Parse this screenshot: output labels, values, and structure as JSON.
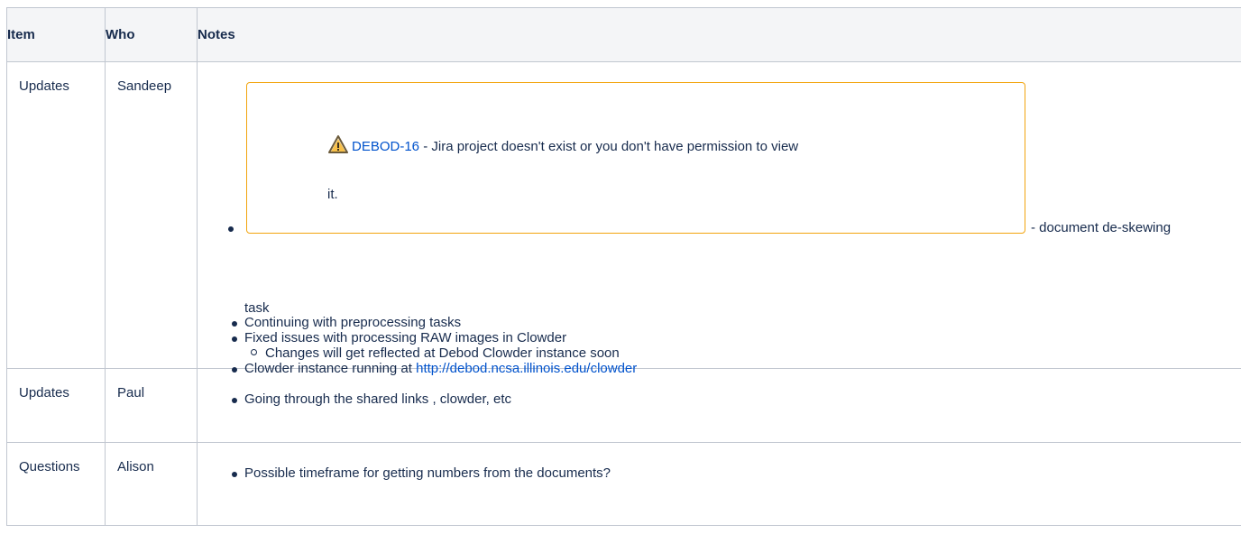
{
  "table": {
    "headers": {
      "item": "Item",
      "who": "Who",
      "notes": "Notes"
    },
    "rows": [
      {
        "item": "Updates",
        "who": "Sandeep",
        "jira": {
          "icon": "warning-icon",
          "issue_key": "DEBOD-16",
          "message": " - Jira project doesn't exist or you don't have permission to view",
          "message_wrap": "it.",
          "border_color": "#f2a40e"
        },
        "after_jira": "- document de-skewing",
        "after_jira_wrap": "task",
        "bullets": [
          "Continuing with preprocessing tasks",
          "Fixed issues with processing RAW images in Clowder"
        ],
        "sub_bullet": "Changes will get reflected at Debod Clowder instance soon",
        "last_bullet_prefix": "Clowder instance running at ",
        "last_bullet_link": "http://debod.ncsa.illinois.edu/clowder"
      },
      {
        "item": "Updates",
        "who": "Paul",
        "bullets": [
          "Going through the shared links , clowder, etc"
        ]
      },
      {
        "item": "Questions",
        "who": "Alison",
        "bullets": [
          "Possible timeframe for getting numbers from the documents?"
        ]
      }
    ]
  },
  "colors": {
    "link": "#0052cc",
    "text": "#172b4d",
    "header_bg": "#f4f5f7",
    "border": "#c1c7d0"
  }
}
